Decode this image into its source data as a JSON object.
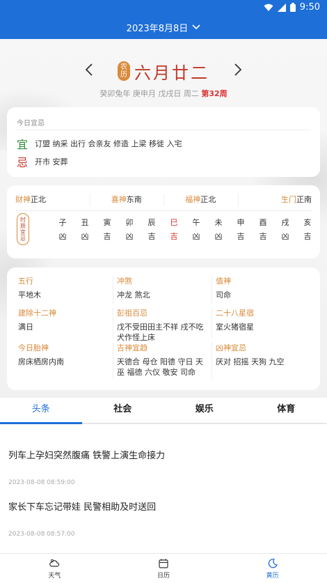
{
  "status": {
    "time": "9:50"
  },
  "header": {
    "date": "2023年8月8日"
  },
  "lunar": {
    "seal_top": "农",
    "seal_bottom": "历",
    "date": "六月廿二",
    "ganzhi": "癸卯兔年 庚申月 戊戌日",
    "weekday": "周二",
    "week_no": "第32周"
  },
  "yiji": {
    "title": "今日宜忌",
    "yi_glyph": "宜",
    "yi_text": "订盟 纳采 出行 会亲友 修造 上梁 移徙 入宅",
    "ji_glyph": "忌",
    "ji_text": "开市 安葬"
  },
  "gods": [
    {
      "label": "财神",
      "value": "正北"
    },
    {
      "label": "喜神",
      "value": "东南"
    },
    {
      "label": "福神",
      "value": "正北"
    },
    {
      "label": "生门",
      "value": "正南"
    }
  ],
  "hour_seal": [
    "时",
    "辰",
    "宜",
    "忌"
  ],
  "hours": [
    {
      "branch": "子",
      "fortune": "凶"
    },
    {
      "branch": "丑",
      "fortune": "凶"
    },
    {
      "branch": "寅",
      "fortune": "吉"
    },
    {
      "branch": "卯",
      "fortune": "凶"
    },
    {
      "branch": "辰",
      "fortune": "吉"
    },
    {
      "branch": "巳",
      "fortune": "吉",
      "active": true
    },
    {
      "branch": "午",
      "fortune": "凶"
    },
    {
      "branch": "未",
      "fortune": "凶"
    },
    {
      "branch": "申",
      "fortune": "吉"
    },
    {
      "branch": "酉",
      "fortune": "吉"
    },
    {
      "branch": "戌",
      "fortune": "凶"
    },
    {
      "branch": "亥",
      "fortune": "吉"
    }
  ],
  "details": [
    {
      "label": "五行",
      "value": "平地木"
    },
    {
      "label": "冲煞",
      "value": "冲龙 煞北"
    },
    {
      "label": "值神",
      "value": "司命"
    },
    {
      "label": "建除十二神",
      "value": "满日"
    },
    {
      "label": "彭祖百忌",
      "value": "戊不受田田主不祥 戌不吃犬作怪上床"
    },
    {
      "label": "二十八星宿",
      "value": "室火猪宿星"
    },
    {
      "label": "今日胎神",
      "value": "房床栖房内南"
    },
    {
      "label": "吉神宜趋",
      "value": "天德合 母仓 阳德 守日 天巫 福德 六仪 敬安 司命"
    },
    {
      "label": "凶神宜忌",
      "value": "厌对 招摇 天狗 九空"
    }
  ],
  "tabs": [
    "头条",
    "社会",
    "娱乐",
    "体育"
  ],
  "news": [
    {
      "headline": "列车上孕妇突然腹痛 铁警上演生命接力",
      "time": "2023-08-08 08:59:00"
    },
    {
      "headline": "家长下车忘记带娃 民警相助及时送回",
      "time": "2023-08-08 08:57:00"
    }
  ],
  "bottom_nav": [
    "天气",
    "日历",
    "黄历"
  ],
  "colors": {
    "primary": "#1e6fd8",
    "accent": "#d98a3a",
    "red": "#c0392b",
    "green": "#2e8b3a"
  }
}
